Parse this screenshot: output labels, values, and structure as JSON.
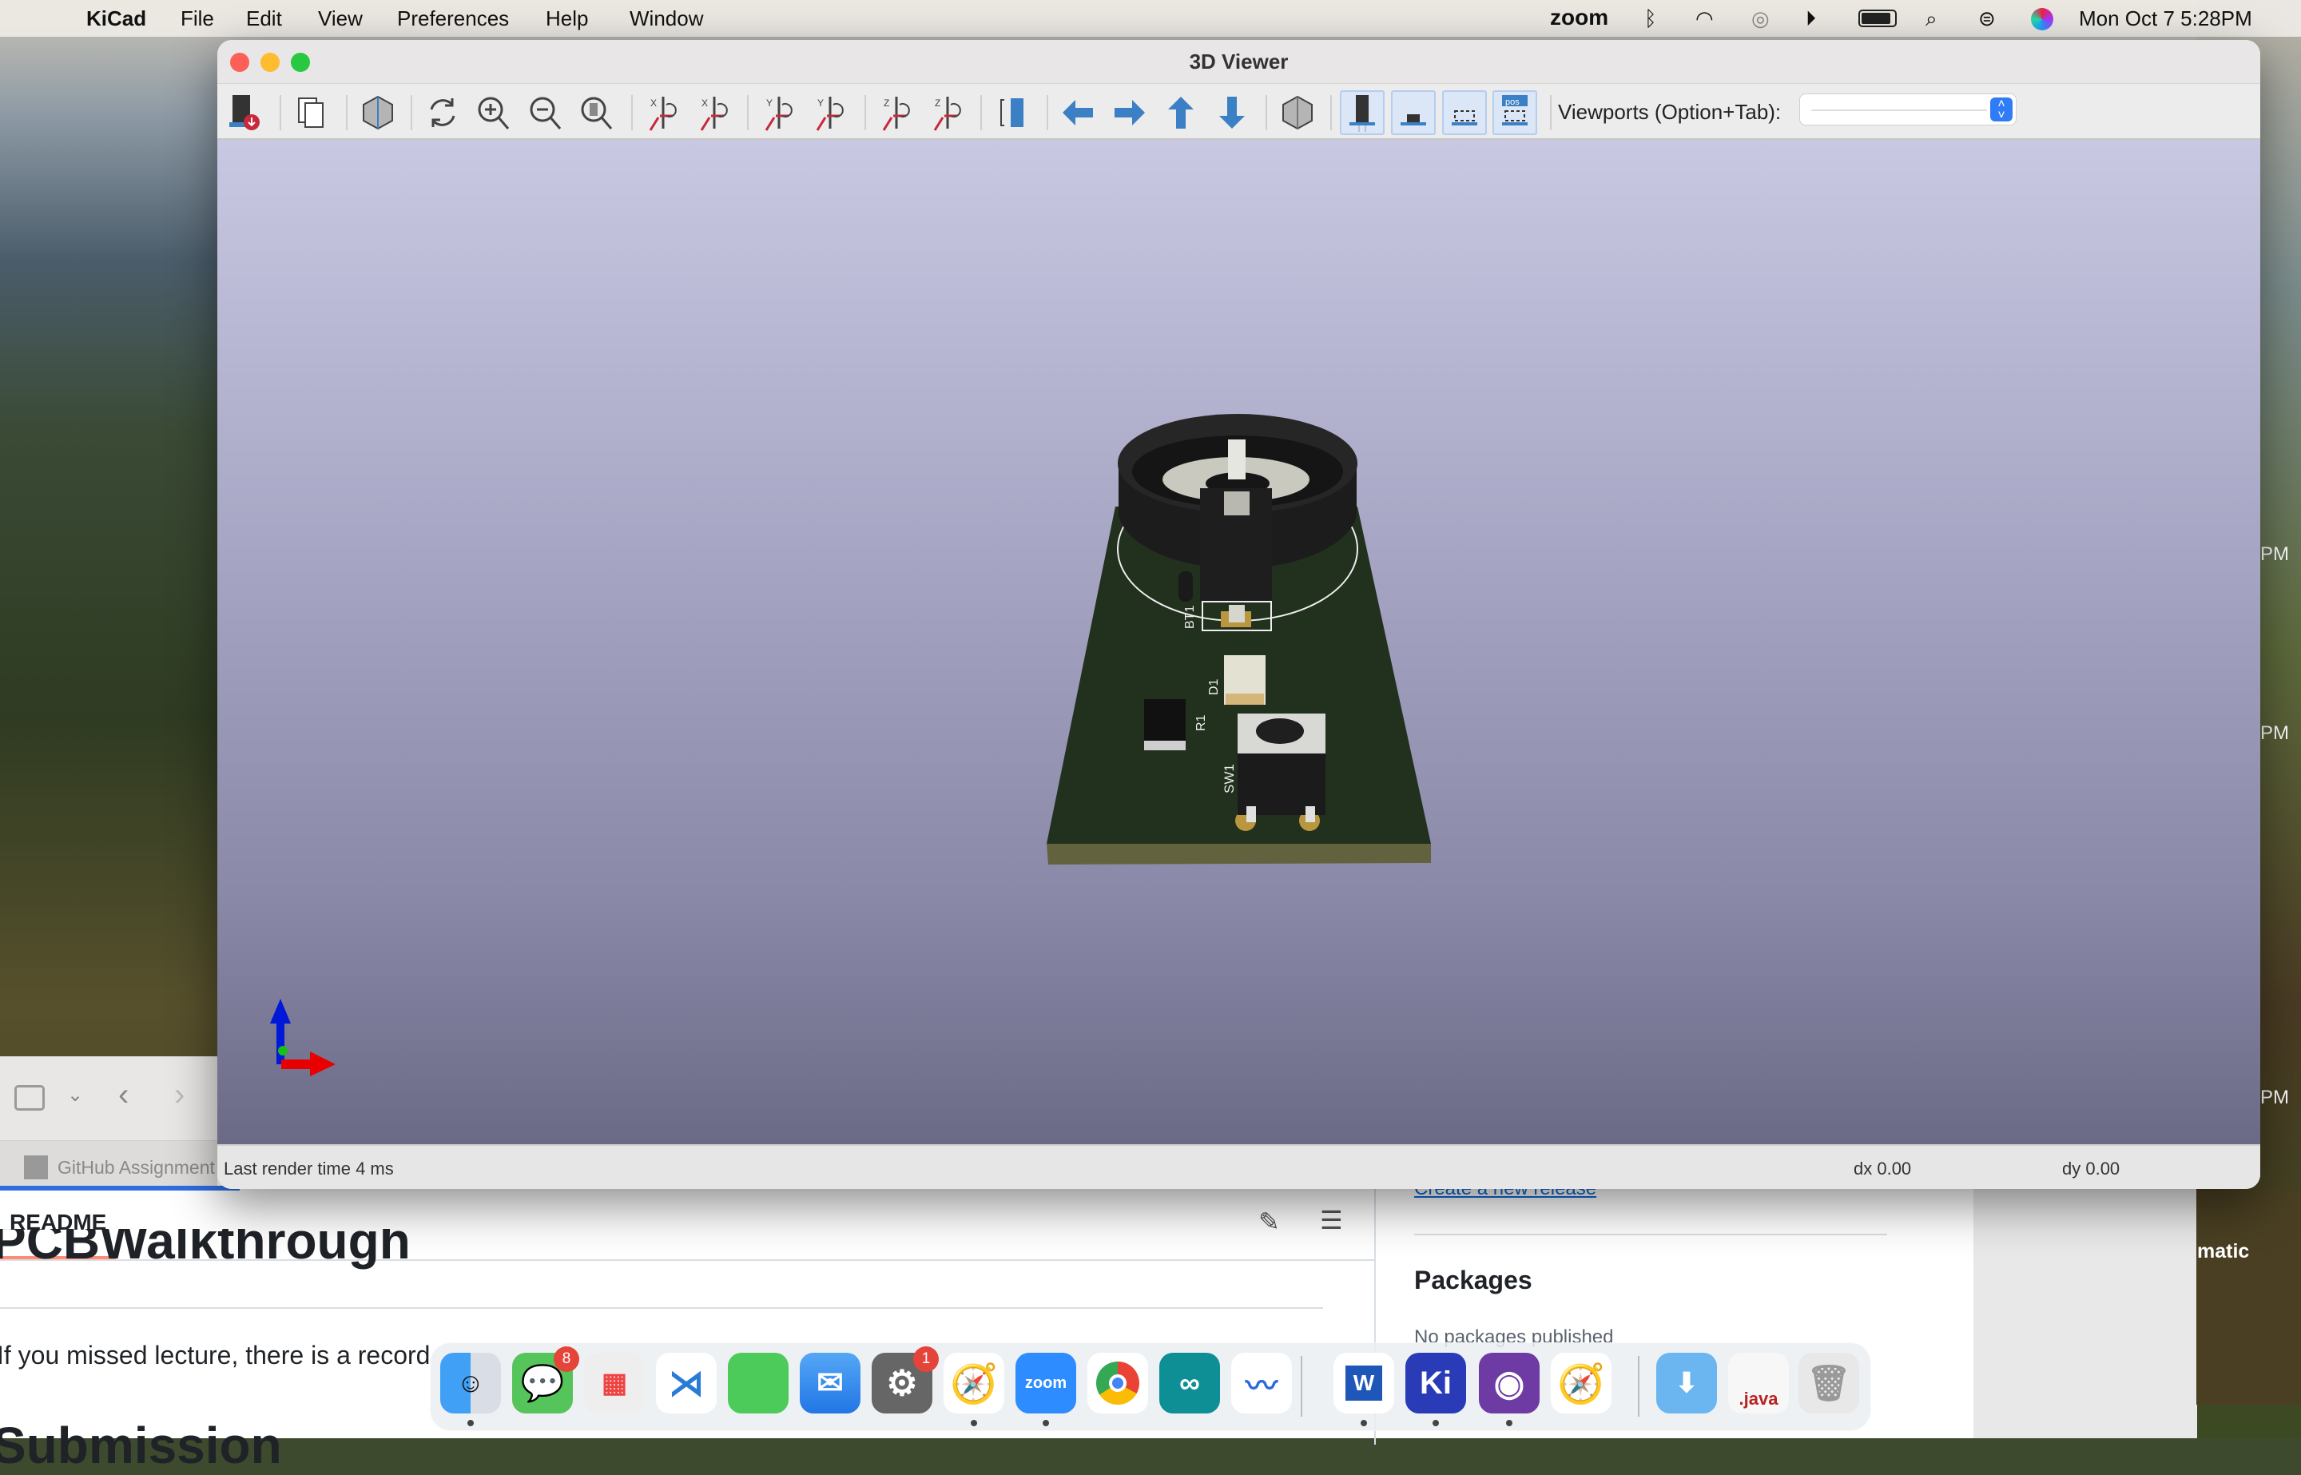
{
  "menubar": {
    "app": "KiCad",
    "items": [
      "File",
      "Edit",
      "View",
      "Preferences",
      "Help",
      "Window"
    ],
    "zoom": "zoom",
    "clock": "Mon Oct 7  5:28PM"
  },
  "window": {
    "title": "3D Viewer",
    "viewports_label": "Viewports (Option+Tab):",
    "viewports_value": "",
    "toolbar": [
      "export-image",
      "copy-to-clipboard",
      "render-raytrace",
      "reload-board",
      "zoom-in",
      "zoom-out",
      "zoom-fit",
      "rotate-x-cw",
      "rotate-x-ccw",
      "rotate-y-cw",
      "rotate-y-ccw",
      "rotate-z-cw",
      "rotate-z-ccw",
      "flip-board",
      "move-left",
      "move-right",
      "move-up",
      "move-down",
      "view-orthographic",
      "show-tht",
      "show-smd",
      "show-virtual",
      "show-not-in-posfile"
    ]
  },
  "pcb": {
    "labels": {
      "bt1": "BT1",
      "d1": "D1",
      "r1": "R1",
      "sw1": "SW1"
    },
    "colors": {
      "board": "#22301e",
      "edge": "#63623f",
      "silk": "#f0f0f0",
      "pad": "#b8973f"
    }
  },
  "status": {
    "render": "Last render time 4 ms",
    "dx": "dx 0.00",
    "dy": "dy 0.00"
  },
  "background": {
    "tab": "GitHub Assignment",
    "readme": "README",
    "heading": "PCBWalkthrough",
    "para": "If you missed lecture, there is a record",
    "heading2": "Submission",
    "release": "Create a new release",
    "packages": "Packages",
    "no_packages": "No packages published",
    "pm1": "PM",
    "pm2": "PM",
    "pm3": "PM",
    "matic": "matic"
  },
  "dock": {
    "apps": [
      "Finder",
      "Messages",
      "Launchpad",
      "VS Code",
      "FaceTime",
      "Mail",
      "System Settings",
      "Safari",
      "zoom",
      "Chrome",
      "Arduino",
      "Freeform",
      "Word",
      "KiCad",
      "GitHub Desktop",
      "Safari Beta",
      "Downloads",
      "java",
      "Trash"
    ],
    "messages_badge": "8",
    "settings_badge": "1",
    "zoom_label": "zoom",
    "kicad_label": "Ki",
    "java_label": ".java"
  }
}
